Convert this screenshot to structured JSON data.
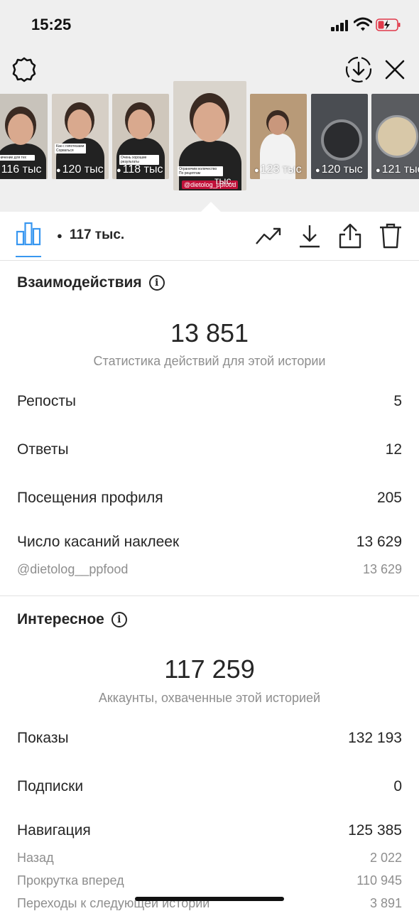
{
  "status_bar": {
    "time": "15:25"
  },
  "thumbnails": [
    {
      "views": "116 тыс",
      "bg": "#c8c3bb"
    },
    {
      "views": "120 тыс",
      "bg": "#d6cfc6"
    },
    {
      "views": "118 тыс",
      "bg": "#cfc7bc"
    },
    {
      "views": "тыс.",
      "bg": "#d9d4cc",
      "selected": true,
      "chip": "@dietolog_ppfood"
    },
    {
      "views": "123 тыс",
      "bg": "#b89a78"
    },
    {
      "views": "120 тыс",
      "bg": "#4a4d52"
    },
    {
      "views": "121 тыс",
      "bg": "#5a5c60"
    }
  ],
  "action_bar": {
    "views": "117 тыс."
  },
  "interactions": {
    "title": "Взаимодействия",
    "total": "13 851",
    "caption": "Статистика действий для этой истории",
    "rows": [
      {
        "label": "Репосты",
        "value": "5"
      },
      {
        "label": "Ответы",
        "value": "12"
      },
      {
        "label": "Посещения профиля",
        "value": "205"
      },
      {
        "label": "Число касаний наклеек",
        "value": "13 629"
      }
    ],
    "sub_rows": [
      {
        "label": "@dietolog__ppfood",
        "value": "13 629"
      }
    ]
  },
  "discovery": {
    "title": "Интересное",
    "total": "117 259",
    "caption": "Аккаунты, охваченные этой историей",
    "rows": [
      {
        "label": "Показы",
        "value": "132 193"
      },
      {
        "label": "Подписки",
        "value": "0"
      },
      {
        "label": "Навигация",
        "value": "125 385"
      }
    ],
    "sub_rows": [
      {
        "label": "Назад",
        "value": "2 022"
      },
      {
        "label": "Прокрутка вперед",
        "value": "110 945"
      },
      {
        "label": "Переходы к следующей истории",
        "value": "3 891"
      }
    ]
  },
  "colors": {
    "accent": "#3897f0",
    "muted": "#8e8e8e",
    "sticker_red": "#c2123a"
  },
  "icons": [
    "settings-icon",
    "download-circle-icon",
    "close-icon",
    "bar-chart-icon",
    "eye-icon",
    "trend-icon",
    "download-icon",
    "share-icon",
    "trash-icon",
    "info-icon"
  ]
}
